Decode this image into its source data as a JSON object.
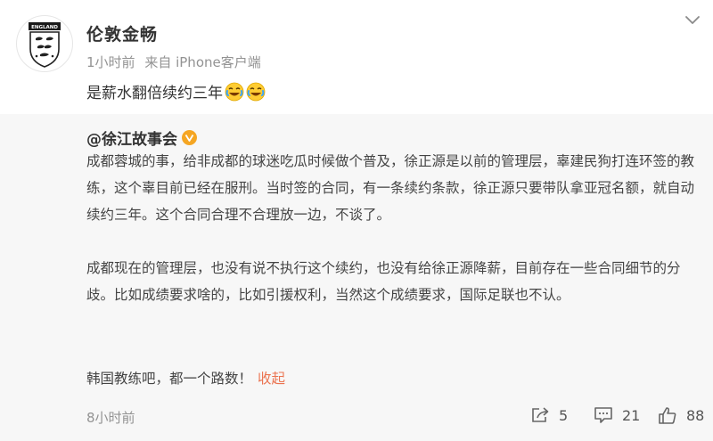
{
  "post": {
    "username": "伦敦金畅",
    "avatar_label": "ENGLAND",
    "time": "1小时前",
    "source": "来自 iPhone客户端",
    "text": "是薪水翻倍续约三年",
    "emojis": [
      "laugh-cry-emoji",
      "laugh-cry-emoji"
    ],
    "menu_icon": "chevron-down-icon"
  },
  "repost": {
    "author": "@徐江故事会",
    "badge_icon": "verified-badge-icon",
    "paragraphs": [
      "成都蓉城的事，给非成都的球迷吃瓜时候做个普及，徐正源是以前的管理层，辜建民狗打连环签的教练，这个辜目前已经在服刑。当时签的合同，有一条续约条款，徐正源只要带队拿亚冠名额，就自动续约三年。这个合同合理不合理放一边，不谈了。",
      "成都现在的管理层，也没有说不执行这个续约，也没有给徐正源降薪，目前存在一些合同细节的分歧。比如成绩要求啥的，比如引援权利，当然这个成绩要求，国际足联也不认。",
      "韩国教练吧，都一个路数！"
    ],
    "collapse_label": "收起",
    "time": "8小时前",
    "actions": {
      "repost_count": "5",
      "comment_count": "21",
      "like_count": "88"
    },
    "accent_color": "#eb7350",
    "badge_color": "#f5a623"
  }
}
